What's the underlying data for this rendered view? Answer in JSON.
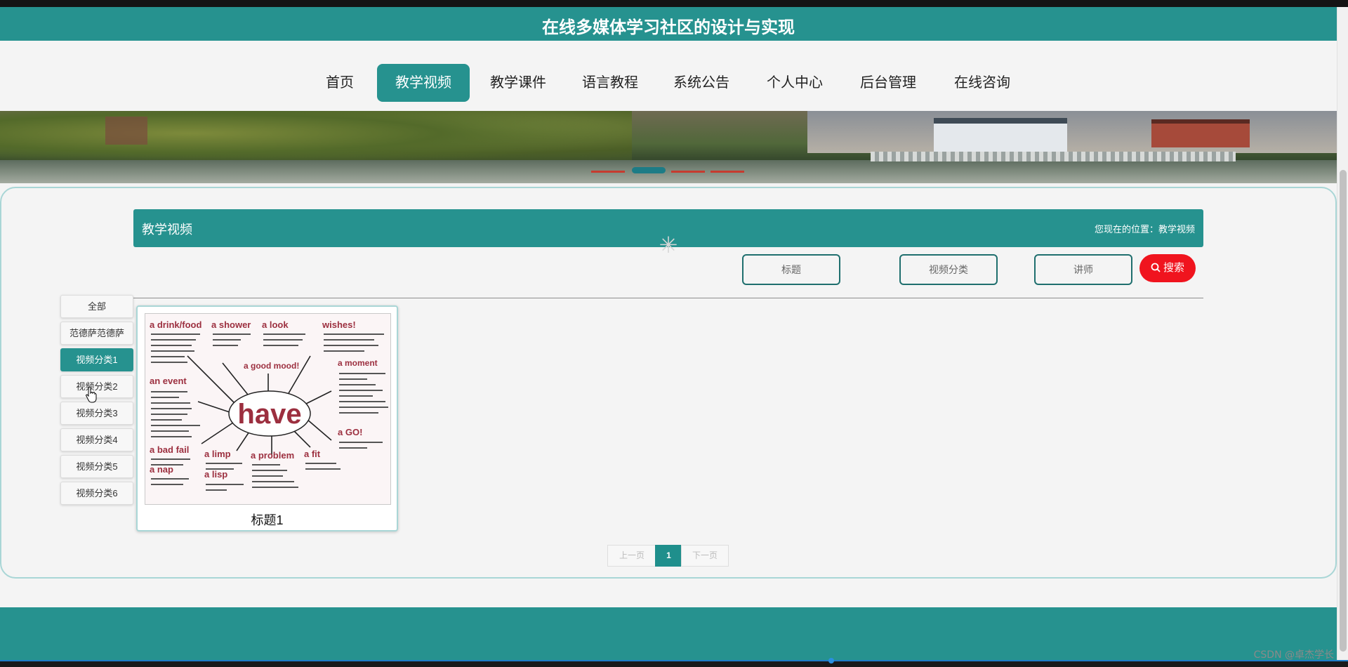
{
  "header": {
    "title": "在线多媒体学习社区的设计与实现"
  },
  "nav": {
    "items": [
      {
        "label": "首页",
        "active": false
      },
      {
        "label": "教学视频",
        "active": true
      },
      {
        "label": "教学课件",
        "active": false
      },
      {
        "label": "语言教程",
        "active": false
      },
      {
        "label": "系统公告",
        "active": false
      },
      {
        "label": "个人中心",
        "active": false
      },
      {
        "label": "后台管理",
        "active": false
      },
      {
        "label": "在线咨询",
        "active": false
      }
    ]
  },
  "section": {
    "title": "教学视频",
    "breadcrumb": "您现在的位置：教学视频"
  },
  "search": {
    "title_placeholder": "标题",
    "category_placeholder": "视频分类",
    "lecturer_placeholder": "讲师",
    "button_label": "搜索"
  },
  "categories": [
    {
      "label": "全部",
      "active": false
    },
    {
      "label": "范德萨范德萨",
      "active": false
    },
    {
      "label": "视频分类1",
      "active": true
    },
    {
      "label": "视频分类2",
      "active": false
    },
    {
      "label": "视频分类3",
      "active": false
    },
    {
      "label": "视频分类4",
      "active": false
    },
    {
      "label": "视频分类5",
      "active": false
    },
    {
      "label": "视频分类6",
      "active": false
    }
  ],
  "videos": [
    {
      "title": "标题1",
      "thumbnail": {
        "center_word": "have",
        "phrases": [
          "a drink/food",
          "a shower",
          "a look",
          "wishes!",
          "a good mood!",
          "a moment",
          "an event",
          "a GO!",
          "a bad fail",
          "a limp",
          "a problem",
          "a fit",
          "a nap",
          "a lisp"
        ]
      }
    }
  ],
  "pagination": {
    "prev": "上一页",
    "current": "1",
    "next": "下一页"
  },
  "watermark": "CSDN @卓杰学长",
  "colors": {
    "primary": "#26928f",
    "search_button": "#f0141e",
    "footer": "#26928f"
  }
}
